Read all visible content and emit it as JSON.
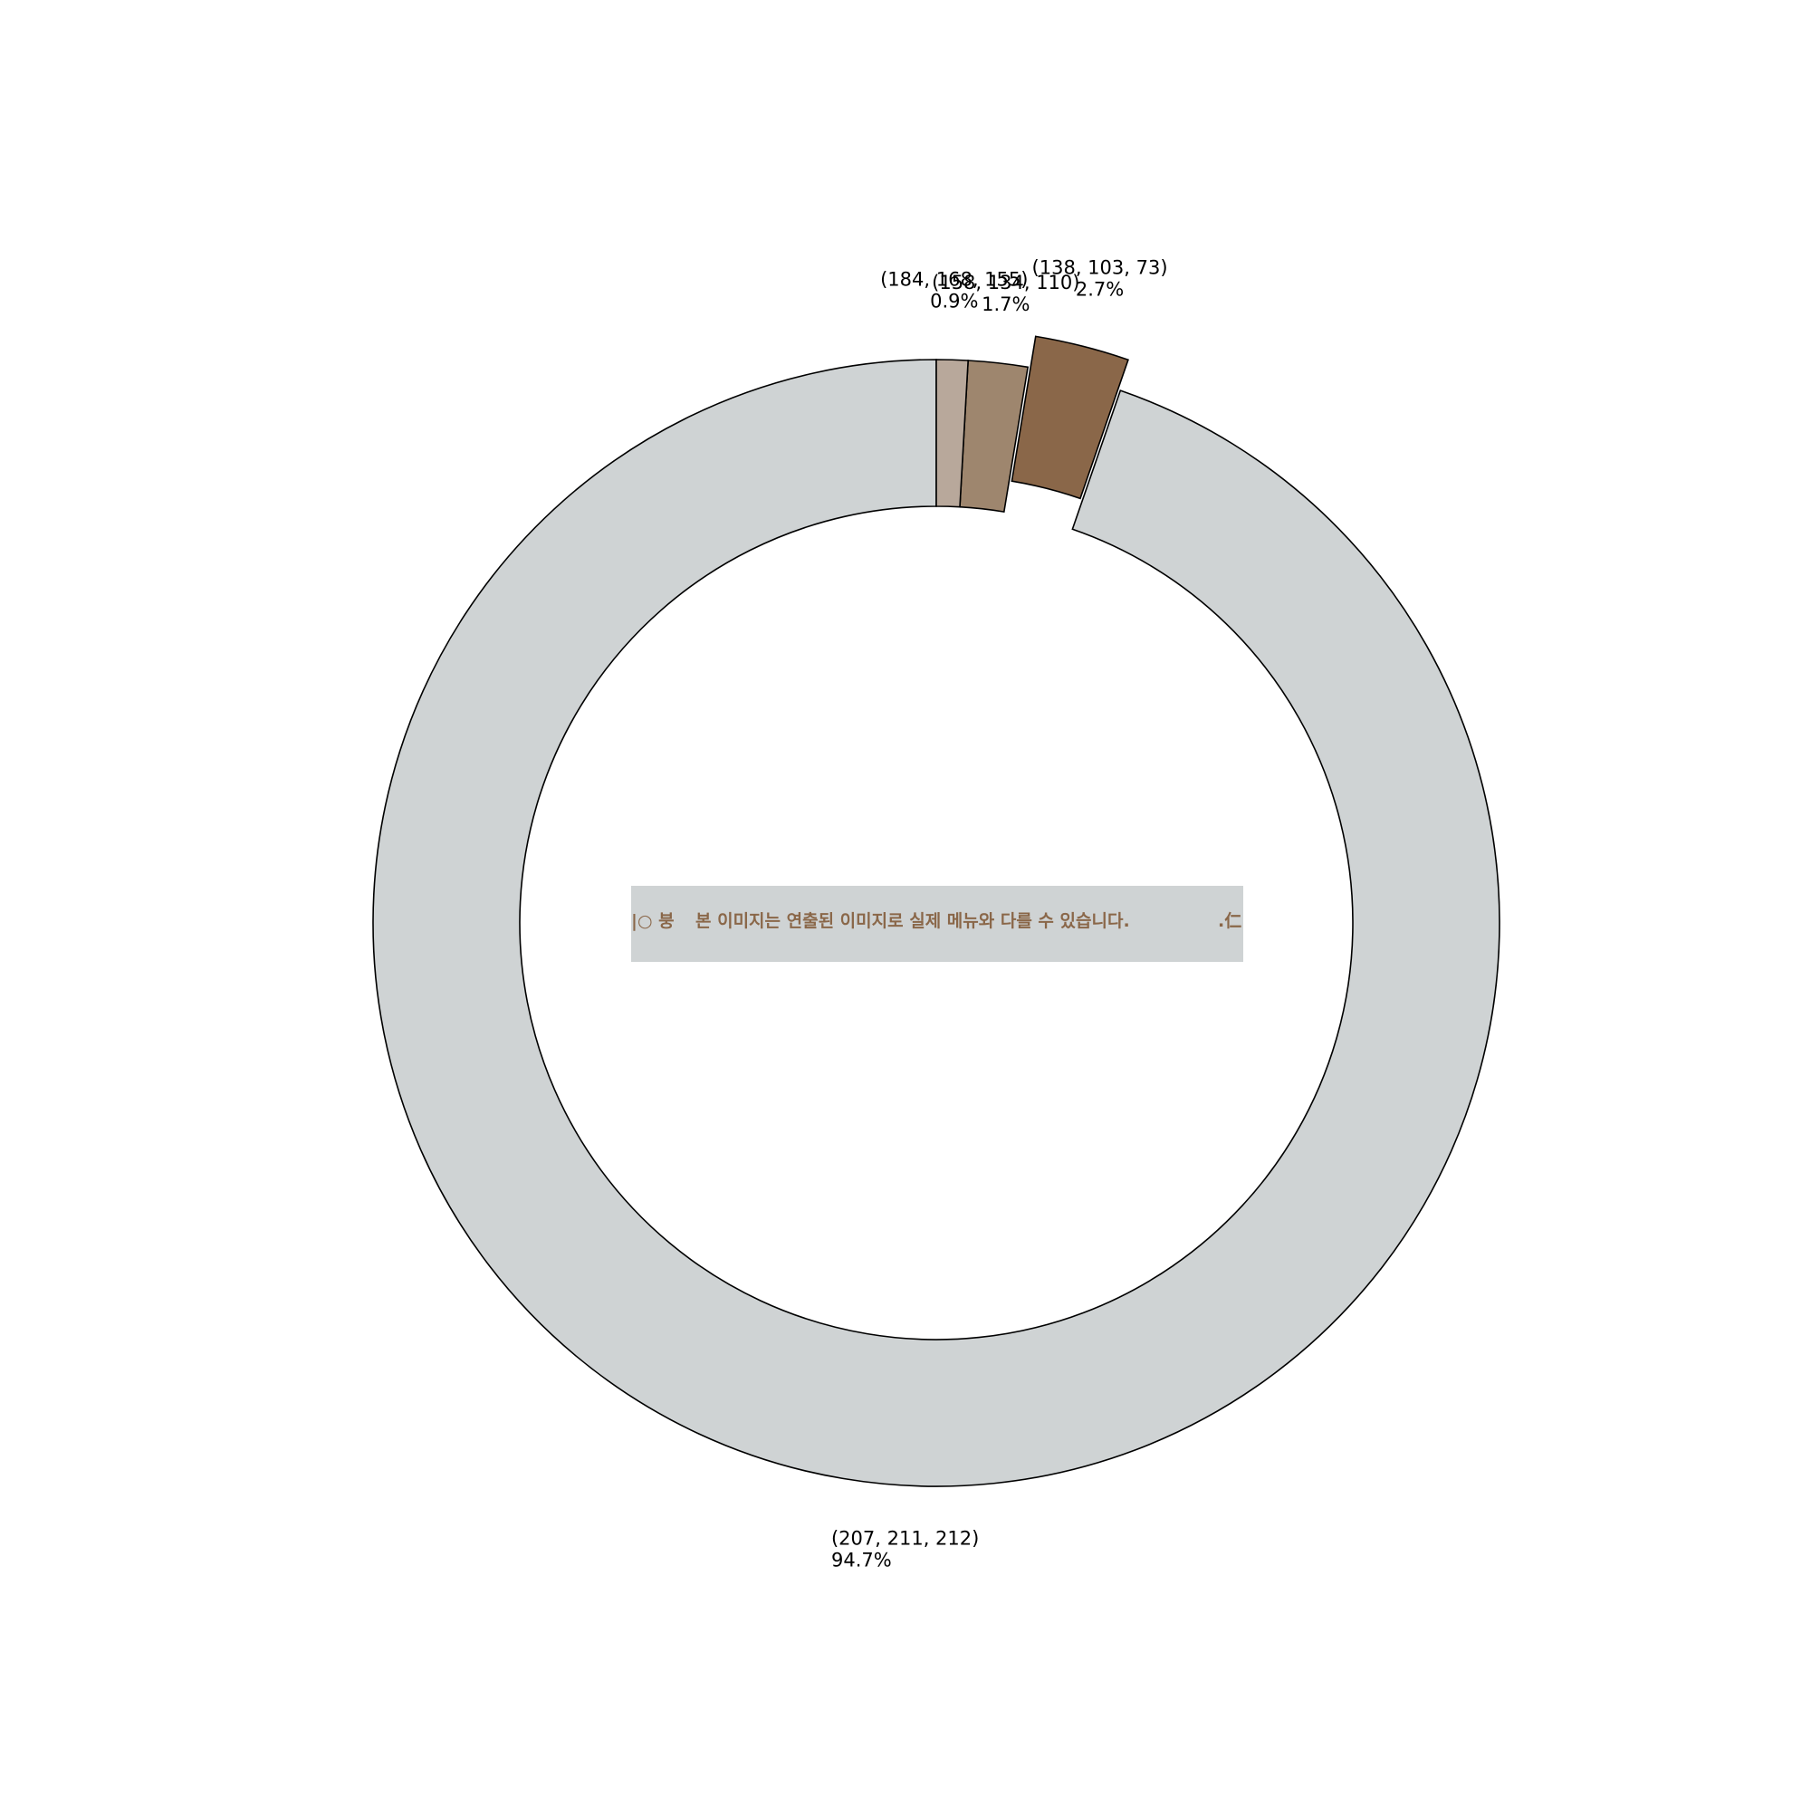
{
  "chart_data": {
    "type": "pie",
    "style": "donut",
    "explode": "largest-dark-slice",
    "start": "top, counter-clockwise",
    "slices": [
      {
        "label": "(207, 211, 212)",
        "pct_label": "94.7%",
        "value": 94.7,
        "color": "#cfd3d4"
      },
      {
        "label": "(138, 103, 73)",
        "pct_label": "2.7%",
        "value": 2.7,
        "color": "#8a6749"
      },
      {
        "label": "(158, 134, 110)",
        "pct_label": "1.7%",
        "value": 1.7,
        "color": "#9e866e"
      },
      {
        "label": "(184, 168, 155)",
        "pct_label": "0.9%",
        "value": 0.9,
        "color": "#b8a89b"
      }
    ]
  },
  "center_image": {
    "text": "본 이미지는 연출된 이미지로 실제 메뉴와 다를 수 있습니다.",
    "left_fragment": "|○ 붕",
    "right_fragment": ".仁",
    "background": "#cfd3d4",
    "text_color": "#8a6749"
  }
}
